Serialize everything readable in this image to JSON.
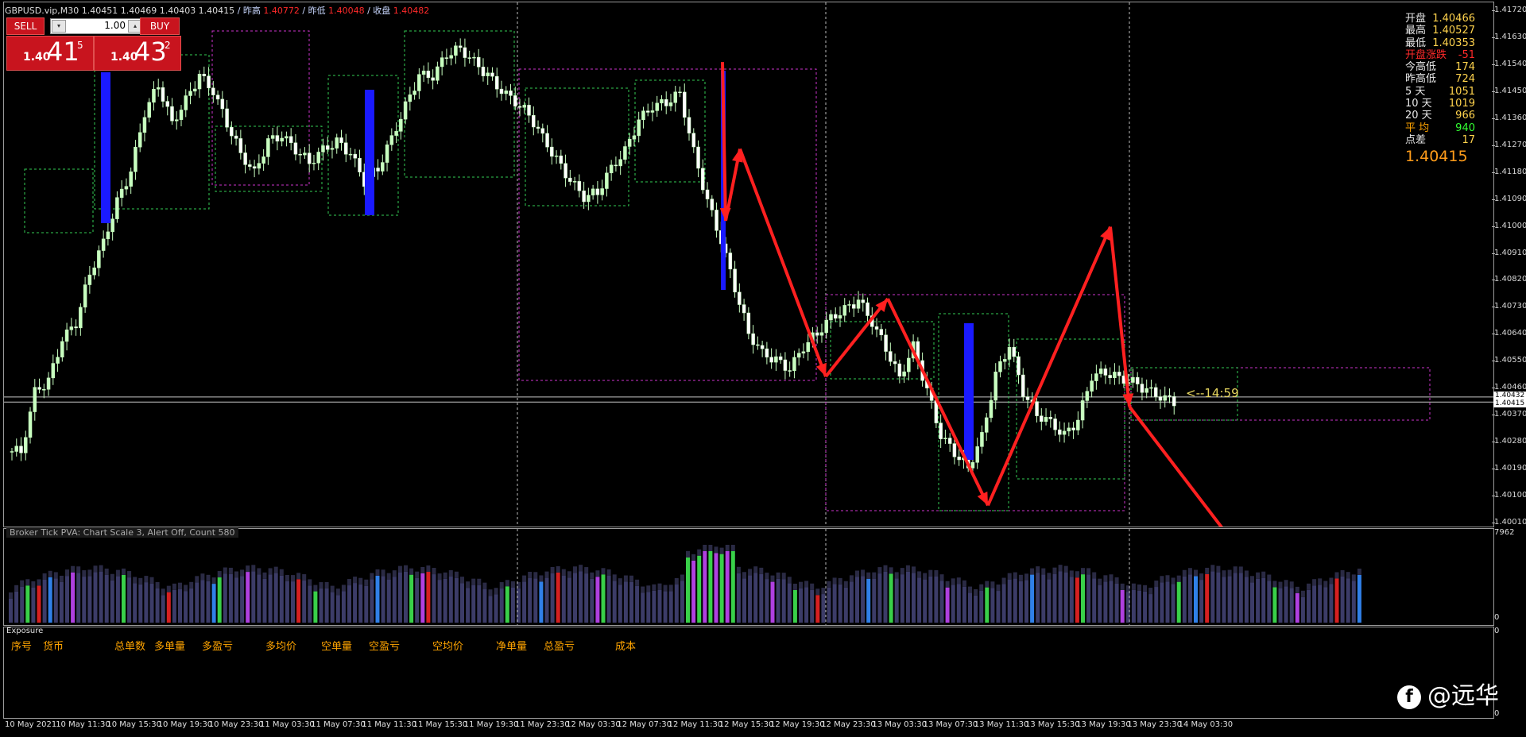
{
  "header": {
    "symbol_line": "GBPUSD.vip,M30  1.40451 1.40469 1.40403 1.40415",
    "prev_high_label": "/ 昨高",
    "prev_high": "1.40772",
    "prev_low_label": "/ 昨低",
    "prev_low": "1.40048",
    "prev_close_label": "/ 收盘",
    "prev_close": "1.40482"
  },
  "trade_panel": {
    "sell_label": "SELL",
    "buy_label": "BUY",
    "lot": "1.00",
    "sell_quote": {
      "small": "1.40",
      "big": "41",
      "sup": "5"
    },
    "buy_quote": {
      "small": "1.40",
      "big": "43",
      "sup": "2"
    }
  },
  "info_panel": {
    "rows": [
      {
        "k": "开盘",
        "v": "1.40466",
        "kcolor": "#e8e8e8",
        "vcolor": "#ffd34d"
      },
      {
        "k": "最高",
        "v": "1.40527",
        "kcolor": "#e8e8e8",
        "vcolor": "#ffd34d"
      },
      {
        "k": "最低",
        "v": "1.40353",
        "kcolor": "#e8e8e8",
        "vcolor": "#ffd34d"
      },
      {
        "k": "开盘涨跌",
        "v": "-51",
        "kcolor": "#ff2a2a",
        "vcolor": "#ff2a2a"
      },
      {
        "k": "今高低",
        "v": "174",
        "kcolor": "#e8e8e8",
        "vcolor": "#ffd34d"
      },
      {
        "k": "昨高低",
        "v": "724",
        "kcolor": "#e8e8e8",
        "vcolor": "#ffd34d"
      },
      {
        "k": "5  天",
        "v": "1051",
        "kcolor": "#e8e8e8",
        "vcolor": "#ffd34d"
      },
      {
        "k": "10 天",
        "v": "1019",
        "kcolor": "#e8e8e8",
        "vcolor": "#ffd34d"
      },
      {
        "k": "20 天",
        "v": "966",
        "kcolor": "#e8e8e8",
        "vcolor": "#ffd34d"
      },
      {
        "k": "平  均",
        "v": "940",
        "kcolor": "#ffa400",
        "vcolor": "#33ff33"
      },
      {
        "k": "点差",
        "v": "17",
        "kcolor": "#e8e8e8",
        "vcolor": "#ffd34d"
      }
    ],
    "current_price": "1.40415"
  },
  "price_axis": [
    "1.41720",
    "1.41630",
    "1.41540",
    "1.41450",
    "1.41360",
    "1.41270",
    "1.41180",
    "1.41090",
    "1.41000",
    "1.40910",
    "1.40820",
    "1.40730",
    "1.40640",
    "1.40550",
    "1.40460",
    "1.40370",
    "1.40280",
    "1.40190",
    "1.40100",
    "1.40010"
  ],
  "price_tags": {
    "ask": "1.40432",
    "bid": "1.40415"
  },
  "countdown": "<--14:59",
  "indicator": {
    "title": "Broker Tick  PVA:  Chart Scale  3,  Alert Off,  Count  580",
    "axis_top": "7962",
    "axis_bottom": "0"
  },
  "exposure": {
    "title": "Exposure",
    "columns": [
      "序号",
      "货币",
      "总单数",
      "多单量",
      "多盈亏",
      "多均价",
      "空单量",
      "空盈亏",
      "空均价",
      "净单量",
      "总盈亏",
      "成本"
    ],
    "axis_top": "0",
    "axis_bottom": "0"
  },
  "time_axis": [
    "10 May 2021",
    "10 May 11:30",
    "10 May 15:30",
    "10 May 19:30",
    "10 May 23:30",
    "11 May 03:30",
    "11 May 07:30",
    "11 May 11:30",
    "11 May 15:30",
    "11 May 19:30",
    "11 May 23:30",
    "12 May 03:30",
    "12 May 07:30",
    "12 May 11:30",
    "12 May 15:30",
    "12 May 19:30",
    "12 May 23:30",
    "13 May 03:30",
    "13 May 07:30",
    "13 May 11:30",
    "13 May 15:30",
    "13 May 19:30",
    "13 May 23:30",
    "14 May 03:30"
  ],
  "watermark": "@远华",
  "colors": {
    "bull": "#c8ffc0",
    "bear": "#ffffff",
    "box_magenta": "#cc33cc",
    "box_green": "#33cc55",
    "arrow": "#ff2020",
    "spike_blue": "#1a1aff"
  },
  "chart_data": {
    "type": "candlestick",
    "symbol": "GBPUSD.vip",
    "timeframe": "M30",
    "ylim": [
      1.4001,
      1.4172
    ],
    "x_ticks": [
      "10 May 2021",
      "10 May 11:30",
      "10 May 15:30",
      "10 May 19:30",
      "10 May 23:30",
      "11 May 03:30",
      "11 May 07:30",
      "11 May 11:30",
      "11 May 15:30",
      "11 May 19:30",
      "11 May 23:30",
      "12 May 03:30",
      "12 May 07:30",
      "12 May 11:30",
      "12 May 15:30",
      "12 May 19:30",
      "12 May 23:30",
      "13 May 03:30",
      "13 May 07:30",
      "13 May 11:30",
      "13 May 15:30",
      "13 May 19:30",
      "13 May 23:30",
      "14 May 03:30"
    ],
    "close_path": [
      1.4025,
      1.4045,
      1.4048,
      1.4062,
      1.4068,
      1.4085,
      1.4095,
      1.4108,
      1.4118,
      1.4138,
      1.4148,
      1.4135,
      1.4142,
      1.415,
      1.4145,
      1.4135,
      1.4125,
      1.4118,
      1.4128,
      1.413,
      1.4126,
      1.4122,
      1.4126,
      1.4128,
      1.4124,
      1.4115,
      1.412,
      1.413,
      1.414,
      1.415,
      1.415,
      1.4158,
      1.416,
      1.4155,
      1.415,
      1.4145,
      1.4142,
      1.4138,
      1.413,
      1.4122,
      1.4115,
      1.411,
      1.4112,
      1.412,
      1.4125,
      1.4135,
      1.414,
      1.4142,
      1.4145,
      1.4125,
      1.4108,
      1.4095,
      1.408,
      1.4065,
      1.4058,
      1.4055,
      1.4052,
      1.406,
      1.4065,
      1.407,
      1.4072,
      1.4075,
      1.4068,
      1.406,
      1.405,
      1.406,
      1.4045,
      1.403,
      1.4025,
      1.402,
      1.403,
      1.405,
      1.406,
      1.4045,
      1.4038,
      1.4035,
      1.403,
      1.4035,
      1.405,
      1.4052,
      1.405,
      1.4048,
      1.4045,
      1.4043,
      1.4042
    ],
    "arrows": [
      {
        "from": 1.4155,
        "to": 1.4102
      },
      {
        "from": 1.4102,
        "to": 1.4126
      },
      {
        "from": 1.4126,
        "to": 1.405
      },
      {
        "from": 1.405,
        "to": 1.4076
      },
      {
        "from": 1.4076,
        "to": 1.4007
      },
      {
        "from": 1.4007,
        "to": 1.41
      },
      {
        "from": 1.41,
        "to": 1.404
      },
      {
        "from": 1.404,
        "to": 1.399
      }
    ]
  }
}
